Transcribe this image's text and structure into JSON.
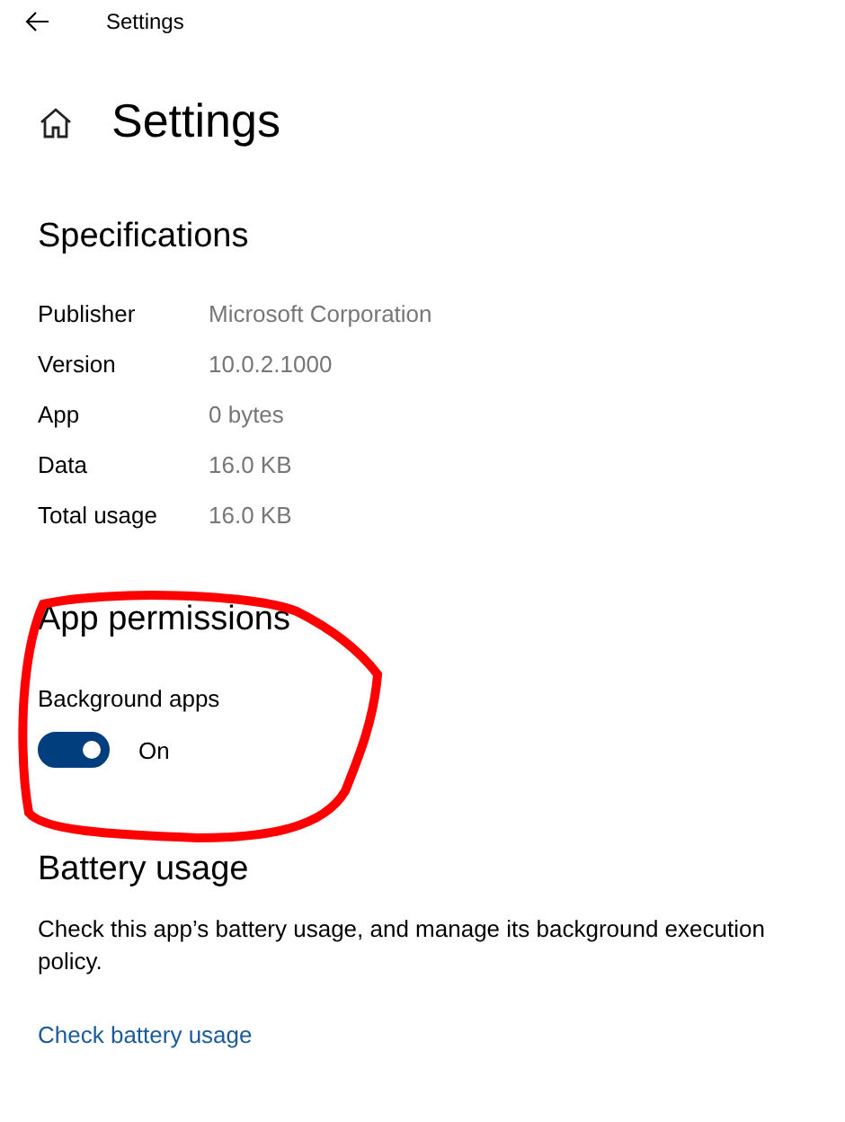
{
  "window": {
    "title": "Settings"
  },
  "page_title": "Settings",
  "specifications": {
    "heading": "Specifications",
    "rows": [
      {
        "label": "Publisher",
        "value": "Microsoft Corporation"
      },
      {
        "label": "Version",
        "value": "10.0.2.1000"
      },
      {
        "label": "App",
        "value": "0 bytes"
      },
      {
        "label": "Data",
        "value": "16.0 KB"
      },
      {
        "label": "Total usage",
        "value": "16.0 KB"
      }
    ]
  },
  "app_permissions": {
    "heading": "App permissions",
    "toggle": {
      "label": "Background apps",
      "on": true,
      "state_text": "On"
    }
  },
  "battery_usage": {
    "heading": "Battery usage",
    "description": "Check this app’s battery usage, and manage its background execution policy.",
    "link": "Check battery usage"
  },
  "annotation": {
    "kind": "circle"
  }
}
